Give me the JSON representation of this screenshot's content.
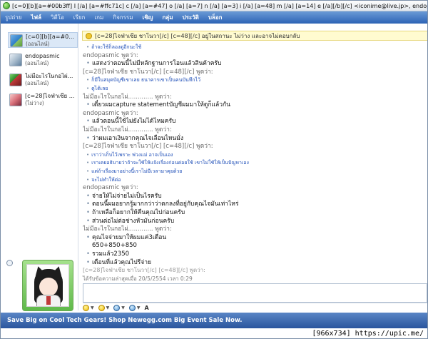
{
  "window": {
    "title": "[c=0][b][a=#00b3ff] I [/a] [a=#ffc71c] c [/a] [a=#47] o [/a] [a=7] n [/a] [a=3] i [/a] [a=48] m [/a] [a=14] e [/a][/b][/c] <iconime@live.jp>, endopasmic"
  },
  "menu": {
    "items": [
      "รูปถ่าย",
      "ไฟล์",
      "วิดีโอ",
      "เรียก",
      "เกม",
      "กิจกรรม",
      "เชิญ",
      "กลุ่ม",
      "ประวัติ",
      "บล็อก"
    ]
  },
  "sidebar": {
    "contacts": [
      {
        "name": "[c=0][b][a=#0...",
        "status": "(ออนไลน์)"
      },
      {
        "name": "endopasmic",
        "status": "(ออนไลน์)"
      },
      {
        "name": "ไม่มีอะไรในกอไผ่...",
        "status": "(ออนไลน์)"
      },
      {
        "name": "[c=28]ไจฟ่าเซีย ...",
        "status": "(ไม่ว่าง)"
      }
    ]
  },
  "infobar": {
    "text": "[c=28]ไจฟ่าเซีย ชาโนวา[/c] [c=48][/c] อยู่ในสถานะ ไม่ว่าง และอาจไม่ตอบกลับ"
  },
  "conversation": {
    "lines": [
      {
        "kind": "small",
        "text": "ถ้าจะใช้ก็ลองดูอีกนะใช้"
      },
      {
        "kind": "sender",
        "text": "endopasmic พูดว่า:"
      },
      {
        "kind": "msg",
        "text": "แสดงว่าตอนนี้ไม่มีหลักฐานการโอนแล้วสินค้าครับ"
      },
      {
        "kind": "sender",
        "text": "[c=28]ไจฟ่าเซีย ชาโนวา[/c] [c=48][/c] พูดว่า:"
      },
      {
        "kind": "small",
        "text": "ก็มีในสมุดบัญชีเขาเลย ธนาคารเขาเป็นคนบันทึกไว้"
      },
      {
        "kind": "small",
        "text": "ดูได้เลย"
      },
      {
        "kind": "sender",
        "text": "ไม่มีอะไรในกอไผ่............. พูดว่า:"
      },
      {
        "kind": "msg",
        "text": "เดี๋ยวผมcapture statementบัญชีผมมาให้ดูก็แล้วกัน"
      },
      {
        "kind": "sender",
        "text": "endopasmic พูดว่า:"
      },
      {
        "kind": "msg",
        "text": "แล้วตอนนี้ใช้ไม่ยังไม่ได้ไหมครับ"
      },
      {
        "kind": "sender",
        "text": "ไม่มีอะไรในกอไผ่............. พูดว่า:"
      },
      {
        "kind": "msg",
        "text": "ว่าผมเอาเงินจากคุณไจเลือนไหนมั่ง"
      },
      {
        "kind": "sender",
        "text": "[c=28]ไจฟ่าเซีย ชาโนวา[/c] [c=48][/c] พูดว่า:"
      },
      {
        "kind": "small",
        "text": "เราว่าเก็บไว้เพราะ พ่วงแม่ อาจเป็นเอง"
      },
      {
        "kind": "small",
        "text": "เราเคยอธิบายว่าถ้าจะใช้ให้แจ้งเรื่องก่อนค่อยใช้ เขาไม่ใช้ให้เป็นปัญหาเอง"
      },
      {
        "kind": "small",
        "text": "แต่ถ้าเรื่องมาอย่างนี้เราไม่มีเวลามาคุยด้วย"
      },
      {
        "kind": "small",
        "text": "จะไม่ทำให้ต่อ"
      },
      {
        "kind": "sender",
        "text": "endopasmic พูดว่า:"
      },
      {
        "kind": "msg",
        "text": "จ่ายให้ไม่จ่ายไม่เป็นไรครับ"
      },
      {
        "kind": "msg",
        "text": "ตอนนี้ผมอยากรู้มากกว่าว่าตกลงที่อยู่กับคุณไจมันเท่าไหร่"
      },
      {
        "kind": "msg",
        "text": "ถ้าเหลือก็อยากให้คืนคุณไปก่อนครับ"
      },
      {
        "kind": "msg",
        "text": "ส่วนต่อไม่ต่อช่างหัวมันก่อนครับ"
      },
      {
        "kind": "sender",
        "text": "ไม่มีอะไรในกอไผ่............. พูดว่า:"
      },
      {
        "kind": "msg",
        "text": "คุณไจจ่ายมาให้ผมแค่3เดือน"
      },
      {
        "kind": "indent",
        "text": "650+850+850"
      },
      {
        "kind": "msg",
        "text": "รวมแล้ว2350"
      },
      {
        "kind": "msg",
        "text": "เดือนที่แล้วคุณไปรีจ่าย"
      },
      {
        "kind": "partial",
        "text": "[c=28]ไจฟ่าเซีย ชาโนวา[/c] [c=48][/c] พูดว่า:"
      }
    ]
  },
  "last_message": "ได้รับข้อความล่าสุดเมื่อ 20/5/2554 เวลา 0:29",
  "input": {
    "value": ""
  },
  "emoticons": {
    "text_label": "A"
  },
  "ad": {
    "text": "Save Big on Cool Tech Gears! Shop Newegg.com Big Event Sale Now."
  },
  "watermark": "[966x734] https://upic.me/",
  "colors": {
    "menu_bar": "#2d63b5",
    "ad_bar": "#2a559d",
    "link_blue": "#1f4fb8",
    "info_bg": "#fffbd0"
  }
}
